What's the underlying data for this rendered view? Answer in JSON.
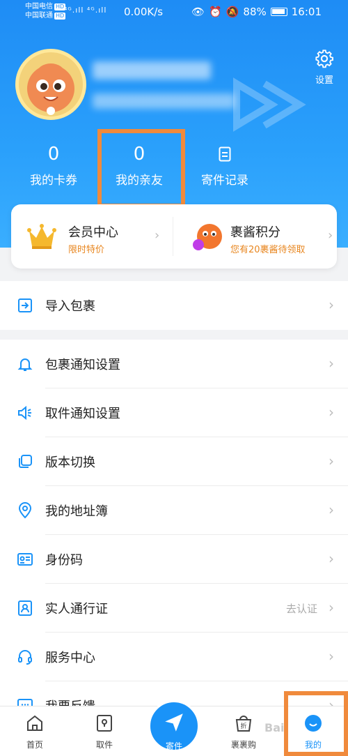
{
  "status_bar": {
    "carrier1": "中国电信",
    "carrier2": "中国联通",
    "hd": "HD",
    "signal": "⁴ᴳ.ıll ⁴ᴳ.ıll",
    "speed": "0.00K/s",
    "battery": "88%",
    "time": "16:01"
  },
  "header": {
    "settings_label": "设置"
  },
  "stats": [
    {
      "value": "0",
      "label": "我的卡券"
    },
    {
      "value": "0",
      "label": "我的亲友"
    },
    {
      "label": "寄件记录"
    }
  ],
  "member_card": {
    "left_title": "会员中心",
    "left_sub": "限时特价",
    "right_title": "裹酱积分",
    "right_sub": "您有20裹酱待领取"
  },
  "menu_top": [
    {
      "label": "导入包裹"
    }
  ],
  "menu": [
    {
      "label": "包裹通知设置",
      "icon": "bell-icon"
    },
    {
      "label": "取件通知设置",
      "icon": "speaker-icon"
    },
    {
      "label": "版本切换",
      "icon": "switch-icon"
    },
    {
      "label": "我的地址簿",
      "icon": "location-icon"
    },
    {
      "label": "身份码",
      "icon": "id-card-icon"
    },
    {
      "label": "实人通行证",
      "icon": "person-icon",
      "extra": "去认证"
    },
    {
      "label": "服务中心",
      "icon": "headset-icon"
    },
    {
      "label": "我要反馈",
      "icon": "feedback-icon"
    }
  ],
  "bottom_nav": [
    {
      "label": "首页",
      "icon": "home-icon"
    },
    {
      "label": "取件",
      "icon": "pickup-icon"
    },
    {
      "label": "寄件",
      "icon": "send-icon"
    },
    {
      "label": "裹裹购",
      "icon": "shop-icon"
    },
    {
      "label": "我的",
      "icon": "profile-icon"
    }
  ],
  "watermark": "Bai",
  "colors": {
    "primary": "#1a93f8",
    "accent_orange": "#e8861f",
    "highlight": "#f08a3c"
  }
}
